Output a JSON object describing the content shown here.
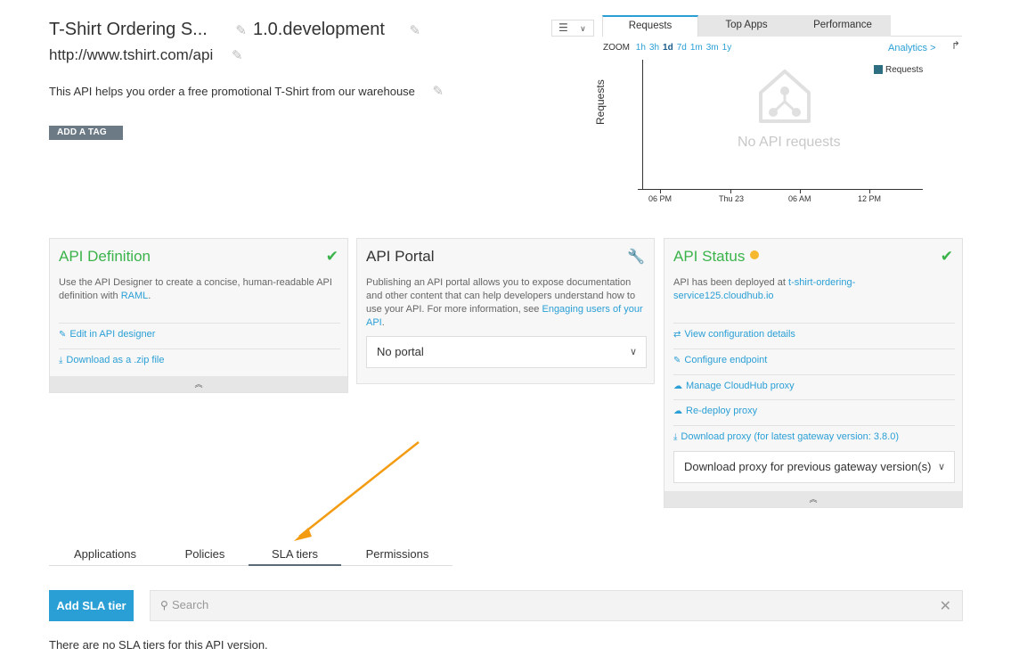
{
  "header": {
    "title": "T-Shirt Ordering S...",
    "version": "1.0.development",
    "url": "http://www.tshirt.com/api",
    "description": "This API helps you order a free promotional T-Shirt from our warehouse",
    "add_tag_label": "ADD A TAG"
  },
  "chart_panel": {
    "tabs": [
      {
        "label": "Requests",
        "active": true
      },
      {
        "label": "Top Apps",
        "active": false
      },
      {
        "label": "Performance",
        "active": false
      }
    ],
    "zoom_label": "ZOOM",
    "zoom_options": [
      "1h",
      "3h",
      "1d",
      "7d",
      "1m",
      "3m",
      "1y"
    ],
    "zoom_selected": "1d",
    "analytics_link": "Analytics >",
    "empty_text": "No API requests"
  },
  "chart_data": {
    "type": "line",
    "title": "",
    "ylabel": "Requests",
    "xlabel": "",
    "x_ticks": [
      "06 PM",
      "Thu 23",
      "06 AM",
      "12 PM"
    ],
    "series": [
      {
        "name": "Requests",
        "values": []
      }
    ],
    "legend": "top-right",
    "legend_color": "#2d6e80",
    "grid": false
  },
  "cards": {
    "definition": {
      "title": "API Definition",
      "body_prefix": "Use the API Designer to create a concise, human-readable API definition with ",
      "body_link": "RAML",
      "body_suffix": ".",
      "links": [
        "Edit in API designer",
        "Download as a .zip file"
      ]
    },
    "portal": {
      "title": "API Portal",
      "body_prefix": "Publishing an API portal allows you to expose documentation and other content that can help developers understand how to use your API. For more information, see ",
      "body_link": "Engaging users of your API",
      "body_suffix": ".",
      "select_value": "No portal"
    },
    "status": {
      "title": "API Status",
      "body_prefix": "API has been deployed at ",
      "body_link": "t-shirt-ordering-service125.cloudhub.io",
      "links": [
        "View configuration details",
        "Configure endpoint",
        "Manage CloudHub proxy",
        "Re-deploy proxy",
        "Download proxy (for latest gateway version: 3.8.0)"
      ],
      "select_value": "Download proxy for previous gateway version(s)",
      "status_color": "#f5b82e"
    }
  },
  "bottom_tabs": [
    {
      "label": "Applications",
      "active": false
    },
    {
      "label": "Policies",
      "active": false
    },
    {
      "label": "SLA tiers",
      "active": true
    },
    {
      "label": "Permissions",
      "active": false
    }
  ],
  "sla": {
    "add_button": "Add SLA tier",
    "search_placeholder": "Search",
    "empty_message": "There are no SLA tiers for this API version."
  },
  "colors": {
    "accent": "#2a9fd6",
    "success": "#3bb34a",
    "annotation_arrow": "#f39c12"
  }
}
